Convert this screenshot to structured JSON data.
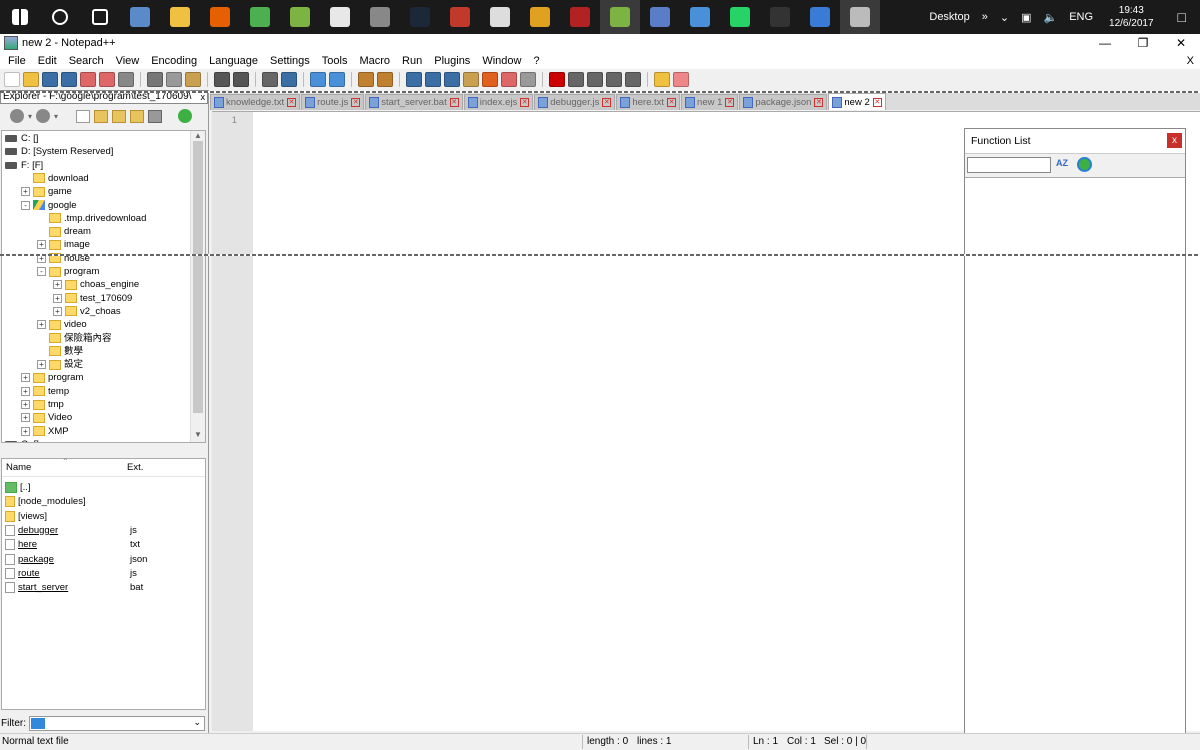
{
  "taskbar": {
    "apps": [
      "windows-start",
      "search",
      "task-view",
      "control-panel",
      "file-explorer",
      "firefox",
      "chrome",
      "browser",
      "charts",
      "world-of-tanks",
      "steam",
      "game",
      "calculator",
      "tool",
      "filezilla",
      "notepad-plus-plus",
      "whiteboard",
      "paper-plane",
      "whatsapp",
      "terminal",
      "remote-desktop",
      "box"
    ],
    "desktop_label": "Desktop",
    "language": "ENG",
    "time": "19:43",
    "date": "12/6/2017"
  },
  "window": {
    "title": "new 2 - Notepad++",
    "close_doc": "X"
  },
  "menu": [
    "File",
    "Edit",
    "Search",
    "View",
    "Encoding",
    "Language",
    "Settings",
    "Tools",
    "Macro",
    "Run",
    "Plugins",
    "Window",
    "?"
  ],
  "explorer": {
    "title": "Explorer - F:\\google\\program\\test_170609\\",
    "close": "x",
    "tree": [
      {
        "label": "C: []",
        "kind": "drive",
        "indent": 0,
        "exp": ""
      },
      {
        "label": "D: [System Reserved]",
        "kind": "drive",
        "indent": 0,
        "exp": ""
      },
      {
        "label": "F: [F]",
        "kind": "drive",
        "indent": 0,
        "exp": ""
      },
      {
        "label": "download",
        "kind": "folder",
        "indent": 1,
        "exp": ""
      },
      {
        "label": "game",
        "kind": "folder",
        "indent": 1,
        "exp": "+"
      },
      {
        "label": "google",
        "kind": "gdrive",
        "indent": 1,
        "exp": "-"
      },
      {
        "label": ".tmp.drivedownload",
        "kind": "folder",
        "indent": 2,
        "exp": ""
      },
      {
        "label": "dream",
        "kind": "folder",
        "indent": 2,
        "exp": ""
      },
      {
        "label": "image",
        "kind": "folder",
        "indent": 2,
        "exp": "+"
      },
      {
        "label": "house",
        "kind": "folder",
        "indent": 2,
        "exp": "+"
      },
      {
        "label": "program",
        "kind": "folder",
        "indent": 2,
        "exp": "-"
      },
      {
        "label": "choas_engine",
        "kind": "folder",
        "indent": 3,
        "exp": "+"
      },
      {
        "label": "test_170609",
        "kind": "folder",
        "indent": 3,
        "exp": "+"
      },
      {
        "label": "v2_choas",
        "kind": "folder",
        "indent": 3,
        "exp": "+"
      },
      {
        "label": "video",
        "kind": "folder",
        "indent": 2,
        "exp": "+"
      },
      {
        "label": "保險箱內容",
        "kind": "folder",
        "indent": 2,
        "exp": ""
      },
      {
        "label": "數學",
        "kind": "folder",
        "indent": 2,
        "exp": ""
      },
      {
        "label": "設定",
        "kind": "folder",
        "indent": 2,
        "exp": "+"
      },
      {
        "label": "program",
        "kind": "folder",
        "indent": 1,
        "exp": "+"
      },
      {
        "label": "temp",
        "kind": "folder",
        "indent": 1,
        "exp": "+"
      },
      {
        "label": "tmp",
        "kind": "folder",
        "indent": 1,
        "exp": "+"
      },
      {
        "label": "Video",
        "kind": "folder",
        "indent": 1,
        "exp": "+"
      },
      {
        "label": "XMP",
        "kind": "folder",
        "indent": 1,
        "exp": "+"
      },
      {
        "label": "G: []",
        "kind": "drive",
        "indent": 0,
        "exp": ""
      }
    ],
    "files_header": {
      "name": "Name",
      "ext": "Ext."
    },
    "files": [
      {
        "name": "[..]",
        "ext": "",
        "icon": "up"
      },
      {
        "name": "[node_modules]",
        "ext": "",
        "icon": "folder"
      },
      {
        "name": "[views]",
        "ext": "",
        "icon": "folder"
      },
      {
        "name": "debugger",
        "ext": "js",
        "icon": "file"
      },
      {
        "name": "here",
        "ext": "txt",
        "icon": "file"
      },
      {
        "name": "package",
        "ext": "json",
        "icon": "file"
      },
      {
        "name": "route",
        "ext": "js",
        "icon": "file"
      },
      {
        "name": "start_server",
        "ext": "bat",
        "icon": "file"
      }
    ],
    "filter_label": "Filter:"
  },
  "tabs": [
    {
      "label": "knowledge.txt",
      "active": false
    },
    {
      "label": "route.js",
      "active": false
    },
    {
      "label": "start_server.bat",
      "active": false
    },
    {
      "label": "index.ejs",
      "active": false
    },
    {
      "label": "debugger.js",
      "active": false
    },
    {
      "label": "here.txt",
      "active": false
    },
    {
      "label": "new 1",
      "active": false
    },
    {
      "label": "package.json",
      "active": false
    },
    {
      "label": "new 2",
      "active": true
    }
  ],
  "editor": {
    "line_number": "1"
  },
  "function_list": {
    "title": "Function List",
    "close": "x",
    "sort_label": "AZ"
  },
  "status": {
    "filetype": "Normal text file",
    "length": "length : 0",
    "lines": "lines : 1",
    "ln": "Ln : 1",
    "col": "Col : 1",
    "sel": "Sel : 0 | 0"
  },
  "colors": {
    "taskbar_bg": "#1a1a1a",
    "active_tab": "#ffffff",
    "close_red": "#c8302c"
  }
}
